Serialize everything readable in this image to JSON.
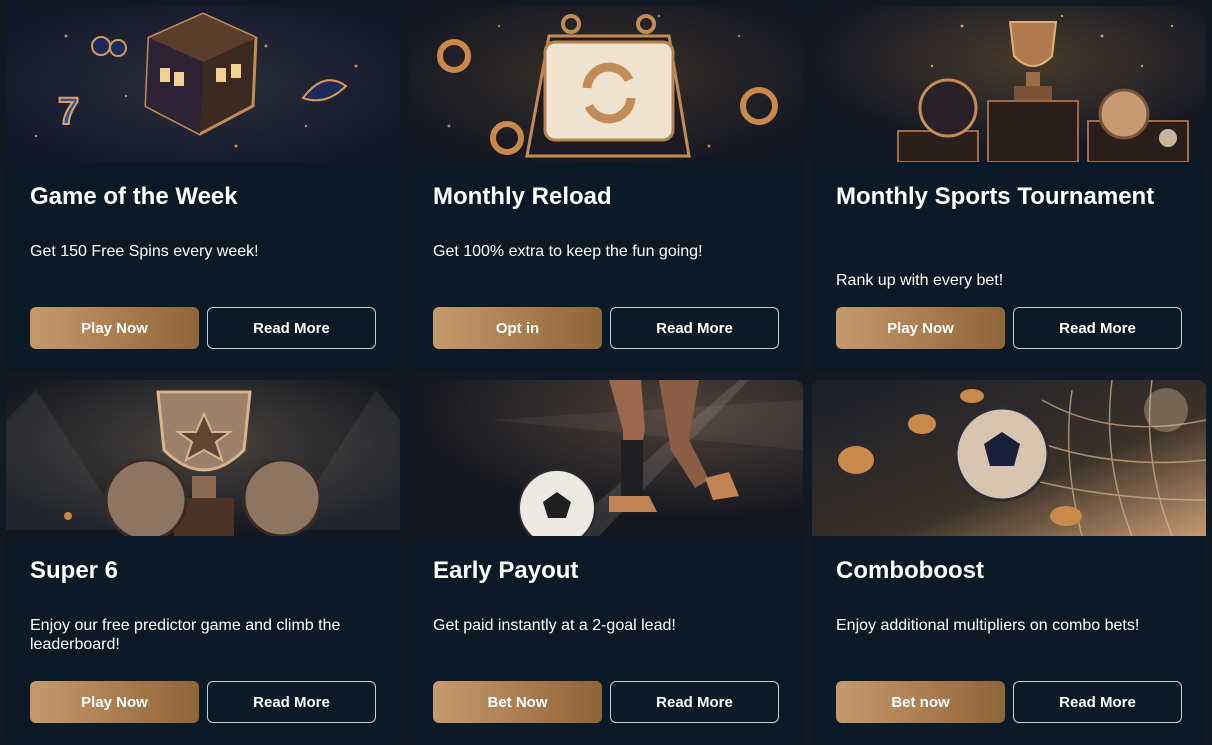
{
  "cards": [
    {
      "title": "Game of the Week",
      "description": "Get 150 Free Spins every week!",
      "primary": "Play Now",
      "secondary": "Read More"
    },
    {
      "title": "Monthly Reload",
      "description": "Get 100% extra to keep the fun going!",
      "primary": "Opt in",
      "secondary": "Read More"
    },
    {
      "title": "Monthly Sports Tournament",
      "description": "Rank up with every bet!",
      "primary": "Play Now",
      "secondary": "Read More"
    },
    {
      "title": "Super 6",
      "description": "Enjoy our free predictor game and climb the leaderboard!",
      "primary": "Play Now",
      "secondary": "Read More"
    },
    {
      "title": "Early Payout",
      "description": "Get paid instantly at a 2-goal lead!",
      "primary": "Bet Now",
      "secondary": "Read More"
    },
    {
      "title": "Comboboost",
      "description": "Enjoy additional multipliers on combo bets!",
      "primary": "Bet now",
      "secondary": "Read More"
    }
  ],
  "colors": {
    "card_bg": "#0b1a26",
    "page_bg": "#121a25",
    "accent_bronze": "#b68a5c",
    "text": "#ffffff"
  },
  "icons": [
    "slot-cube-icon",
    "calendar-reload-icon",
    "trophy-podium-icon",
    "trophy-balls-icon",
    "football-kick-icon",
    "ball-net-coins-icon"
  ]
}
